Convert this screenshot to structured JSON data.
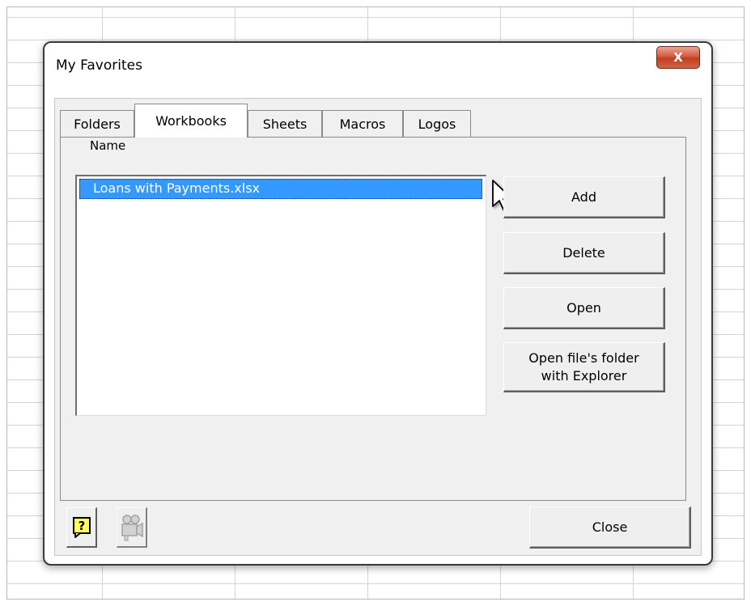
{
  "dialog": {
    "title": "My Favorites",
    "close_glyph": "X"
  },
  "tabs": [
    {
      "label": "Folders",
      "active": false
    },
    {
      "label": "Workbooks",
      "active": true
    },
    {
      "label": "Sheets",
      "active": false
    },
    {
      "label": "Macros",
      "active": false
    },
    {
      "label": "Logos",
      "active": false
    }
  ],
  "list": {
    "column_header": "Name",
    "items": [
      {
        "label": "Loans with Payments.xlsx",
        "selected": true
      }
    ]
  },
  "buttons": {
    "add": "Add",
    "delete": "Delete",
    "open": "Open",
    "open_folder_line1": "Open file's folder",
    "open_folder_line2": "with Explorer",
    "close": "Close"
  },
  "footer_icons": {
    "help": "help-icon",
    "video": "video-camera-icon"
  },
  "colors": {
    "selection": "#3399ff",
    "close_x": "#c13d21"
  }
}
